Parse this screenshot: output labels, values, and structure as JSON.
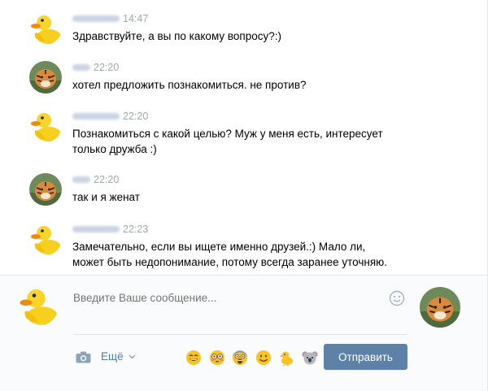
{
  "messages": [
    {
      "sender": "duck",
      "time": "14:47",
      "text": "Здравствуйте, а вы по какому вопросу?:)"
    },
    {
      "sender": "tiger",
      "time": "22:20",
      "text": "хотел предложить познакомиться. не против?"
    },
    {
      "sender": "duck",
      "time": "22:20",
      "text": "Познакомиться с какой целью? Муж у меня есть, интересует\nтолько дружба :)"
    },
    {
      "sender": "tiger",
      "time": "22:20",
      "text": "так и я женат"
    },
    {
      "sender": "duck",
      "time": "22:23",
      "text": "Замечательно, если вы ищете именно друзей.:) Мало ли,\nможет быть недопонимание, потому всегда заранее уточняю."
    }
  ],
  "composer": {
    "placeholder": "Введите Ваше сообщение...",
    "more_label": "Ещё",
    "send_label": "Отправить"
  },
  "emojis": [
    "grin-emoji",
    "flushed-emoji",
    "scream-emoji",
    "smile-emoji",
    "chick-emoji",
    "koala-emoji"
  ],
  "colors": {
    "accent": "#5e81a8",
    "link": "#4f7aa8",
    "timestamp": "#a0a7b0",
    "composer_bg": "#fafbfc"
  }
}
